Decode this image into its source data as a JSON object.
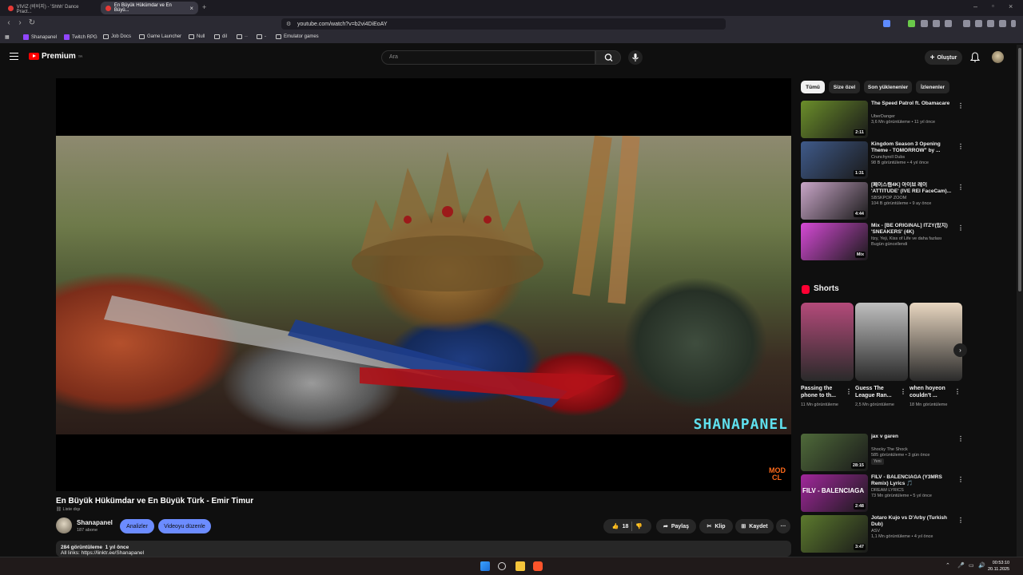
{
  "browser": {
    "tabs": [
      {
        "label": "VIVIZ (비비지) - 'Shhh' Dance Pract..."
      },
      {
        "label": "En Büyük Hükümdar ve En Büyü..."
      }
    ],
    "url": "youtube.com/watch?v=b2vi4DiEoAY",
    "bookmarks": [
      "Shanapanel",
      "Twitch RPG",
      "Job Docs",
      "Game Launcher",
      "Null",
      "dil",
      "··",
      "-",
      "Emulator games"
    ]
  },
  "header": {
    "logo": "Premium",
    "logo_sup": "TR",
    "search_placeholder": "Ara",
    "create_label": "Oluştur"
  },
  "video": {
    "watermark": "SHANAPANEL",
    "corner_logo": "MOD CL",
    "title": "En Büyük Hükümdar ve En Büyük Türk - Emir Timur",
    "visibility": "Liste dışı",
    "channel_name": "Shanapanel",
    "subscribers": "187 abone",
    "analytics_label": "Analizler",
    "edit_label": "Videoyu düzenle",
    "likes": "18",
    "share_label": "Paylaş",
    "clip_label": "Klip",
    "save_label": "Kaydet",
    "views": "284 görüntüleme",
    "age": "1 yıl önce",
    "desc_line": "All links: https://linktr.ee/Shanapanel"
  },
  "chips": [
    "Tümü",
    "Size özel",
    "Son yüklenenler",
    "İzlenenler"
  ],
  "recommendations": [
    {
      "title": "The Speed Patrol ft. Obamacare",
      "channel": "UberDanger",
      "meta": "3,6 Mn görüntüleme • 11 yıl önce",
      "duration": "2:11",
      "color": "#6b8e2a"
    },
    {
      "title": "Kingdom Season 3 Opening Theme - TOMORROW\" by ...",
      "channel": "Crunchyroll Dubs",
      "meta": "98 B görüntüleme • 4 yıl önce",
      "duration": "1:31",
      "color": "#3f5a8a"
    },
    {
      "title": "[페이스캠4K] 아이브 레이 'ATTITUDE' (IVE REI FaceCam)...",
      "channel": "SBSKPOP ZOOM",
      "meta": "104 B görüntüleme • 9 ay önce",
      "duration": "4:44",
      "color": "#c9a6c8"
    },
    {
      "title": "Mix - [BE ORIGINAL] ITZY(있지) 'SNEAKERS' (4K)",
      "channel": "Itzy, Yeji, Kiss of Life ve daha fazlası",
      "meta": "Bugün güncellendi",
      "duration": "Mix",
      "color": "#d64ad6"
    }
  ],
  "shorts": {
    "title": "Shorts",
    "items": [
      {
        "title": "Passing the phone to th...",
        "views": "11 Mn görüntüleme",
        "color": "#b44a7a"
      },
      {
        "title": "Guess The League Ran...",
        "views": "2,5 Mn görüntüleme",
        "color": "#bfbfbf"
      },
      {
        "title": "when hoyeon couldn't ...",
        "views": "18 Mn görüntüleme",
        "color": "#e8d6c0"
      }
    ]
  },
  "recommendations2": [
    {
      "title": "jax v garen",
      "channel": "Shocky The Shock",
      "meta": "585 görüntüleme • 3 gün önce",
      "badge": "Yeni",
      "duration": "28:15",
      "color": "#4f6a3a"
    },
    {
      "title": "FILV - BALENCIAGA (Y3MRS Remix) Lyrics 🎵",
      "channel": "DREAM LYRICS",
      "meta": "73 Mn görüntüleme • 5 yıl önce",
      "duration": "2:48",
      "thumb_text": "FILV - BALENCIAGA",
      "color": "#a1279c"
    },
    {
      "title": "Jotaro Kujo vs D'Arby (Turkish Dub)",
      "channel": "ASV",
      "meta": "1,1 Mn görüntüleme • 4 yıl önce",
      "duration": "3:47",
      "color": "#5c7a2d"
    }
  ],
  "taskbar": {
    "time": "00:53:10",
    "date": "20.11.2025"
  }
}
